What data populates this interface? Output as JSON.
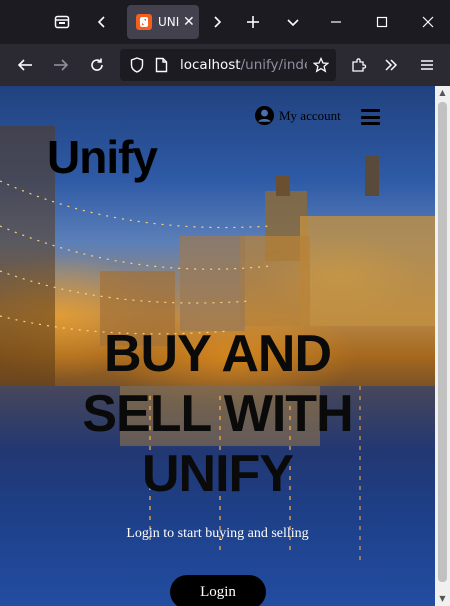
{
  "browser": {
    "tab": {
      "title": "UNIFY",
      "favicon": "xampp-favicon-icon"
    },
    "url": {
      "host": "localhost",
      "path": "/unify/inde"
    }
  },
  "page": {
    "logo": "Unify",
    "account_label": "My account",
    "hero_title_lines": [
      "BUY AND",
      "SELL WITH",
      "UNIFY"
    ],
    "hero_subtitle": "Login to start buying and selling",
    "login_button": "Login"
  }
}
